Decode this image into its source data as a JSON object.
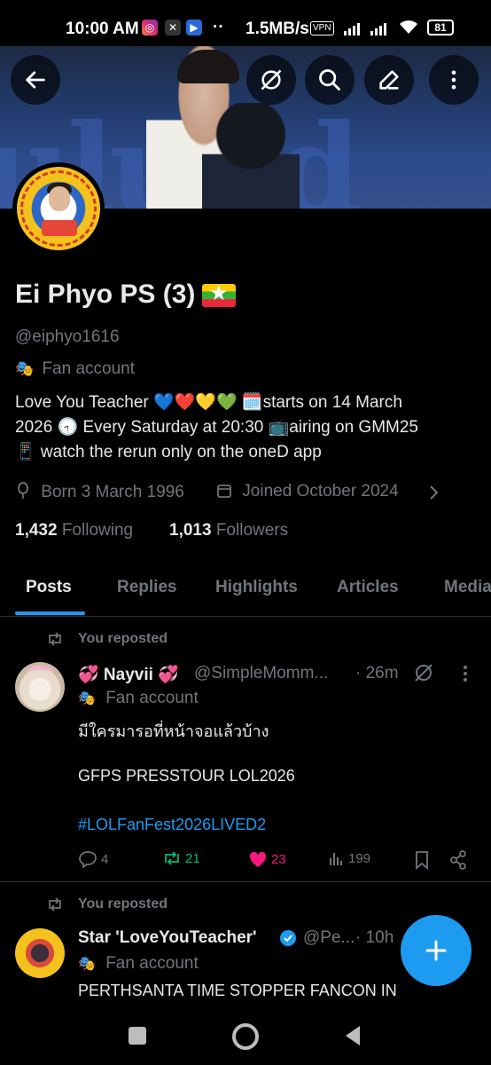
{
  "status_bar": {
    "time": "10:00 AM",
    "net_speed": "1.5MB/s",
    "vpn": "VPN",
    "battery": "81",
    "dots": "··"
  },
  "header": {
    "back_icon": "arrow-left-icon",
    "buttons": [
      "mute-icon",
      "search-icon",
      "edit-icon",
      "more-vertical-icon"
    ]
  },
  "profile": {
    "name": "Ei Phyo PS (3)",
    "flag": "🇲🇲",
    "handle": "@eiphyo1616",
    "label_icon": "🎭",
    "label": "Fan account",
    "bio_line1": "Love You Teacher 💙❤️💛💚 🗓️starts on 14 March",
    "bio_line2": "2026 🕣 Every Saturday at 20:30 📺airing on GMM25",
    "bio_line3": "📱 watch the rerun only on the oneD app",
    "born": "Born 3 March 1996",
    "joined": "Joined October 2024",
    "following_count": "1,432",
    "following_label": "Following",
    "followers_count": "1,013",
    "followers_label": "Followers"
  },
  "tabs": [
    "Posts",
    "Replies",
    "Highlights",
    "Articles",
    "Media"
  ],
  "posts": [
    {
      "repost_label": "You reposted",
      "name": "💞 Nayvii 💞",
      "handle": "@SimpleMomm...",
      "time": "· 26m",
      "label": "Fan account",
      "text_line1": "มีใครมารอที่หน้าจอแล้วบ้าง",
      "text_line2": "GFPS PRESSTOUR LOL2026",
      "hashtag": "#LOLFanFest2026LIVED2",
      "replies": "4",
      "reposts": "21",
      "likes": "23",
      "views": "199"
    },
    {
      "repost_label": "You reposted",
      "name": "Star 'LoveYouTeacher'",
      "handle": "@Pe...",
      "time": "· 10h",
      "label": "Fan account",
      "text_line1": "PERTHSANTA TIME STOPPER FANCON IN"
    }
  ],
  "colors": {
    "accent": "#1d9bf0",
    "repost_green": "#00ba7c",
    "like_pink": "#f91880",
    "muted": "#71767b"
  }
}
